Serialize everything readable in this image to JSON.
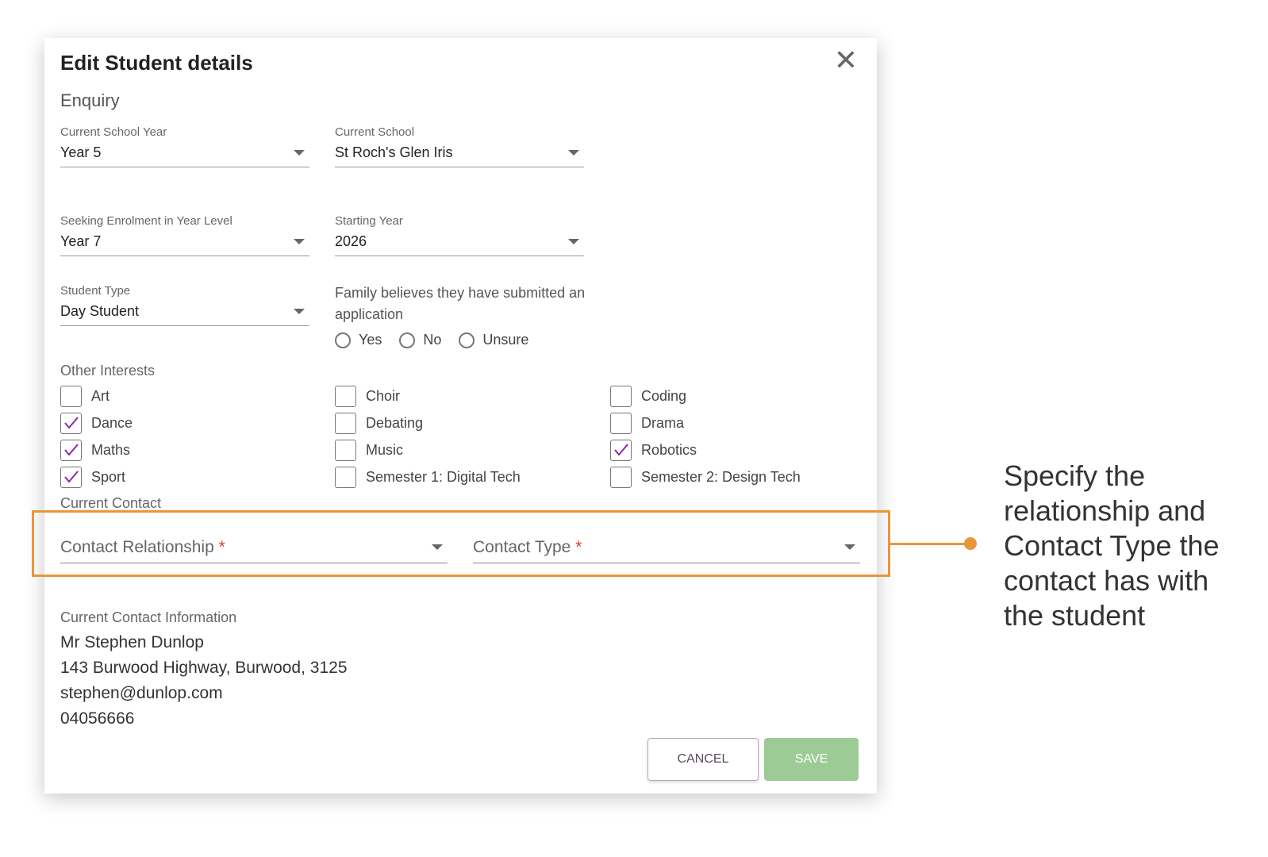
{
  "dialog": {
    "title": "Edit Student details",
    "section": "Enquiry"
  },
  "fields": {
    "current_school_year": {
      "label": "Current School Year",
      "value": "Year 5"
    },
    "current_school": {
      "label": "Current School",
      "value": "St Roch's Glen Iris"
    },
    "seeking_year": {
      "label": "Seeking Enrolment in Year Level",
      "value": "Year 7"
    },
    "starting_year": {
      "label": "Starting Year",
      "value": "2026"
    },
    "student_type": {
      "label": "Student Type",
      "value": "Day Student"
    }
  },
  "application": {
    "question": "Family believes they have submitted an application",
    "options": [
      "Yes",
      "No",
      "Unsure"
    ]
  },
  "interests": {
    "label": "Other Interests",
    "columns": [
      [
        {
          "label": "Art",
          "checked": false
        },
        {
          "label": "Dance",
          "checked": true
        },
        {
          "label": "Maths",
          "checked": true
        },
        {
          "label": "Sport",
          "checked": true
        }
      ],
      [
        {
          "label": "Choir",
          "checked": false
        },
        {
          "label": "Debating",
          "checked": false
        },
        {
          "label": "Music",
          "checked": false
        },
        {
          "label": "Semester 1: Digital Tech",
          "checked": false
        }
      ],
      [
        {
          "label": "Coding",
          "checked": false
        },
        {
          "label": "Drama",
          "checked": false
        },
        {
          "label": "Robotics",
          "checked": true
        },
        {
          "label": "Semester 2: Design Tech",
          "checked": false
        }
      ]
    ]
  },
  "contact": {
    "label": "Current Contact",
    "relationship_placeholder": "Contact Relationship",
    "type_placeholder": "Contact Type",
    "required_mark": "*"
  },
  "contact_info": {
    "label": "Current Contact Information",
    "name": "Mr Stephen Dunlop",
    "address": "143 Burwood Highway, Burwood, 3125",
    "email": "stephen@dunlop.com",
    "phone": "04056666"
  },
  "buttons": {
    "cancel": "CANCEL",
    "save": "SAVE"
  },
  "annotation": {
    "text": "Specify the relationship and Contact Type the contact has with the student"
  },
  "colors": {
    "accent": "#8e24aa",
    "annotation": "#e8963a",
    "save": "#9ccb96"
  }
}
